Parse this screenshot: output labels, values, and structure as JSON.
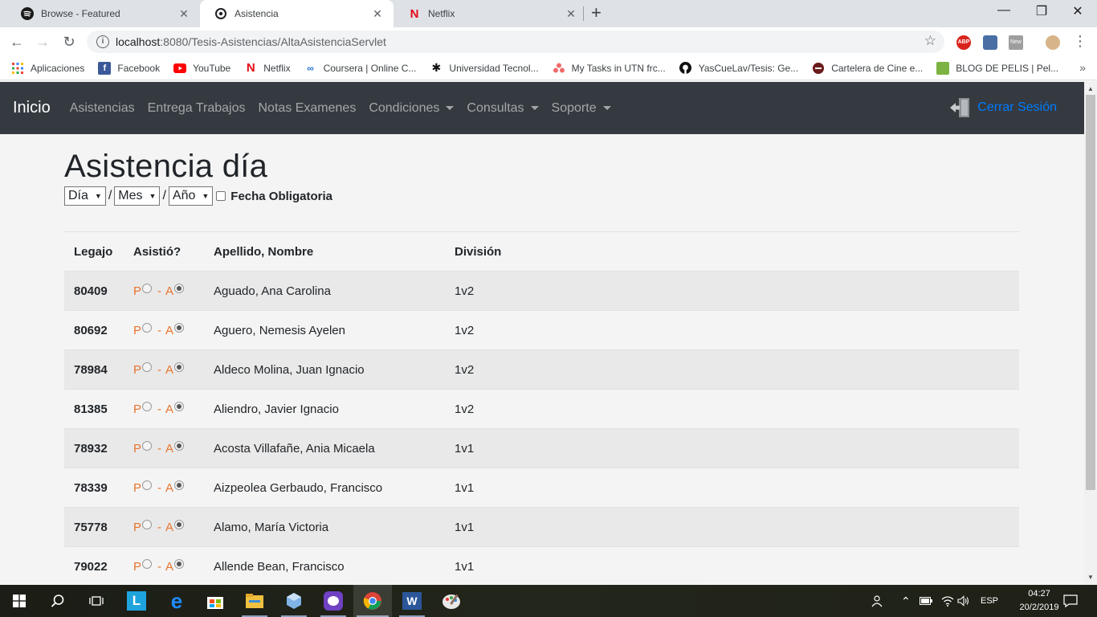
{
  "browser": {
    "tabs": [
      {
        "title": "Browse - Featured",
        "icon": "spotify-icon",
        "active": false
      },
      {
        "title": "Asistencia",
        "icon": "page-icon",
        "active": true
      },
      {
        "title": "Netflix",
        "icon": "netflix-icon",
        "active": false
      }
    ],
    "url_host": "localhost",
    "url_path": ":8080/Tesis-Asistencias/AltaAsistenciaServlet",
    "bookmarks": [
      {
        "label": "Aplicaciones",
        "icon": "apps-grid-icon"
      },
      {
        "label": "Facebook",
        "icon": "facebook-icon"
      },
      {
        "label": "YouTube",
        "icon": "youtube-icon"
      },
      {
        "label": "Netflix",
        "icon": "netflix-icon"
      },
      {
        "label": "Coursera | Online C...",
        "icon": "coursera-icon"
      },
      {
        "label": "Universidad Tecnol...",
        "icon": "utn-icon"
      },
      {
        "label": "My Tasks in UTN frc...",
        "icon": "asana-icon"
      },
      {
        "label": "YasCueLav/Tesis: Ge...",
        "icon": "github-icon"
      },
      {
        "label": "Cartelera de Cine e...",
        "icon": "cinema-icon"
      },
      {
        "label": "BLOG DE PELIS | Pel...",
        "icon": "blog-icon"
      }
    ],
    "extensions": {
      "abp": "ABP",
      "new": "New"
    }
  },
  "navbar": {
    "brand": "Inicio",
    "links": [
      {
        "label": "Asistencias",
        "dropdown": false
      },
      {
        "label": "Entrega Trabajos",
        "dropdown": false
      },
      {
        "label": "Notas Examenes",
        "dropdown": false
      },
      {
        "label": "Condiciones",
        "dropdown": true
      },
      {
        "label": "Consultas",
        "dropdown": true
      },
      {
        "label": "Soporte",
        "dropdown": true
      }
    ],
    "logout": "Cerrar Sesión"
  },
  "page": {
    "title": "Asistencia día",
    "day_select": "Día",
    "month_select": "Mes",
    "year_select": "Año",
    "separator": "/",
    "required_label": "Fecha Obligatoria",
    "required_checked": false
  },
  "table": {
    "headers": {
      "legajo": "Legajo",
      "asistio": "Asistió?",
      "nombre": "Apellido, Nombre",
      "division": "División"
    },
    "present_letter": "P",
    "absent_letter": "A",
    "dash": "-",
    "rows": [
      {
        "legajo": "80409",
        "nombre": "Aguado, Ana Carolina",
        "division": "1v2",
        "asistio": "A"
      },
      {
        "legajo": "80692",
        "nombre": "Aguero, Nemesis Ayelen",
        "division": "1v2",
        "asistio": "A"
      },
      {
        "legajo": "78984",
        "nombre": "Aldeco Molina, Juan Ignacio",
        "division": "1v2",
        "asistio": "A"
      },
      {
        "legajo": "81385",
        "nombre": "Aliendro, Javier Ignacio",
        "division": "1v2",
        "asistio": "A"
      },
      {
        "legajo": "78932",
        "nombre": "Acosta Villafañe, Ania Micaela",
        "division": "1v1",
        "asistio": "A"
      },
      {
        "legajo": "78339",
        "nombre": "Aizpeolea Gerbaudo, Francisco",
        "division": "1v1",
        "asistio": "A"
      },
      {
        "legajo": "75778",
        "nombre": "Alamo, María Victoria",
        "division": "1v1",
        "asistio": "A"
      },
      {
        "legajo": "79022",
        "nombre": "Allende Bean, Francisco",
        "division": "1v1",
        "asistio": "A"
      }
    ]
  },
  "taskbar": {
    "apps": [
      "windows-start-icon",
      "search-icon",
      "task-view-icon",
      "launcher-l-icon",
      "edge-icon",
      "store-icon",
      "file-explorer-icon",
      "virtualbox-icon",
      "github-desktop-icon",
      "chrome-icon",
      "word-icon",
      "paint-icon"
    ],
    "language": "ESP",
    "time": "04:27",
    "date": "20/2/2019"
  },
  "colors": {
    "navbar_bg": "#343a40",
    "link_blue": "#007bff",
    "pa_orange": "#e8742c",
    "row_stripe": "#e9e9e9"
  }
}
